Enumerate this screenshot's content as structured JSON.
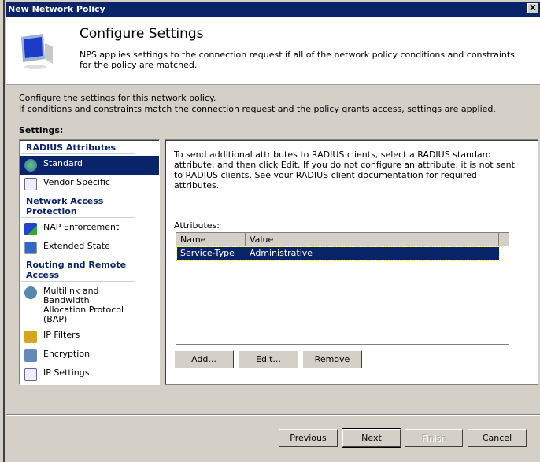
{
  "window": {
    "title": "New Network Policy",
    "close": "X"
  },
  "header": {
    "title": "Configure Settings",
    "description": "NPS applies settings to the connection request if all of the network policy conditions and constraints for the policy are matched."
  },
  "intro": {
    "line1": "Configure the settings for this network policy.",
    "line2": "If conditions and constraints match the connection request and the policy grants access, settings are applied."
  },
  "settings_label": "Settings:",
  "nav": {
    "groups": [
      {
        "title": "RADIUS Attributes",
        "items": [
          "Standard",
          "Vendor Specific"
        ]
      },
      {
        "title": "Network Access Protection",
        "items": [
          "NAP Enforcement",
          "Extended State"
        ]
      },
      {
        "title": "Routing and Remote Access",
        "items": [
          "Multilink and Bandwidth Allocation Protocol (BAP)",
          "IP Filters",
          "Encryption",
          "IP Settings"
        ]
      }
    ],
    "selected": "Standard"
  },
  "panel": {
    "description": "To send additional attributes to RADIUS clients, select a RADIUS standard attribute, and then click Edit. If you do not configure an attribute, it is not sent to RADIUS clients. See your RADIUS client documentation for required attributes.",
    "attributes_label": "Attributes:",
    "columns": [
      "Name",
      "Value"
    ],
    "rows": [
      {
        "name": "Service-Type",
        "value": "Administrative"
      }
    ],
    "buttons": {
      "add": "Add...",
      "edit": "Edit...",
      "remove": "Remove"
    }
  },
  "footer": {
    "previous": "Previous",
    "next": "Next",
    "finish": "Finish",
    "cancel": "Cancel"
  }
}
